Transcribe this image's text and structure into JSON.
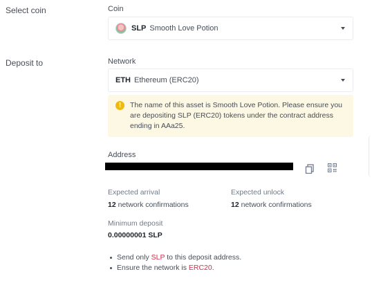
{
  "steps": {
    "select_coin": "Select coin",
    "deposit_to": "Deposit to"
  },
  "coin": {
    "label": "Coin",
    "symbol": "SLP",
    "name": "Smooth Love Potion",
    "icon": "slp-coin-logo"
  },
  "network": {
    "label": "Network",
    "symbol": "ETH",
    "name": "Ethereum (ERC20)"
  },
  "notice": {
    "icon": "warning-icon",
    "text": "The name of this asset is Smooth Love Potion. Please ensure you are depositing SLP (ERC20) tokens under the contract address ending in AAa25."
  },
  "address": {
    "label": "Address",
    "copy_icon": "copy-icon",
    "qr_icon": "qr-code-icon"
  },
  "expected_arrival": {
    "label": "Expected arrival",
    "count": "12",
    "unit": "network confirmations"
  },
  "expected_unlock": {
    "label": "Expected unlock",
    "count": "12",
    "unit": "network confirmations"
  },
  "minimum_deposit": {
    "label": "Minimum deposit",
    "value": "0.00000001 SLP"
  },
  "tips": {
    "tip1_prefix": "Send only ",
    "tip1_highlight": "SLP",
    "tip1_suffix": " to this deposit address.",
    "tip2_prefix": "Ensure the network is ",
    "tip2_highlight": "ERC20",
    "tip2_suffix": "."
  },
  "colors": {
    "highlight": "#cf304a",
    "notice_bg": "#fcf8e3",
    "warning": "#f0b90b"
  }
}
